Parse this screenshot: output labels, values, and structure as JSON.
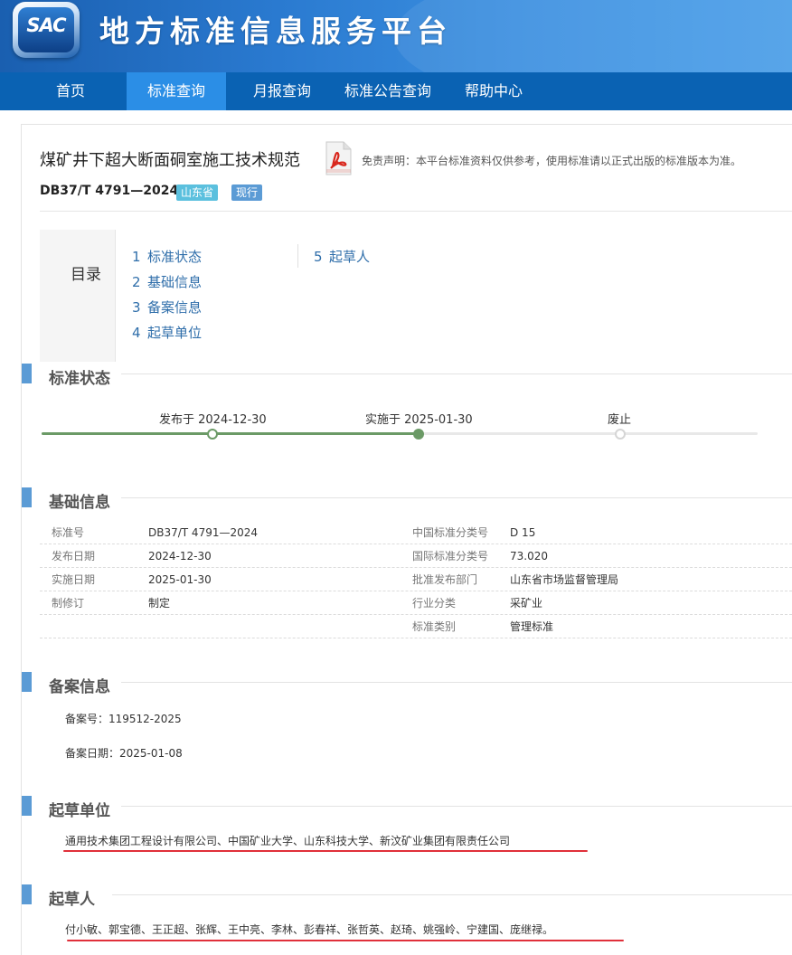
{
  "header": {
    "logo_text": "SAC",
    "site_title": "地方标准信息服务平台"
  },
  "nav": {
    "items": [
      {
        "label": "首页",
        "active": false
      },
      {
        "label": "标准查询",
        "active": true
      },
      {
        "label": "月报查询",
        "active": false
      },
      {
        "label": "标准公告查询",
        "active": false
      },
      {
        "label": "帮助中心",
        "active": false
      }
    ]
  },
  "doc": {
    "title": "煤矿井下超大断面硐室施工技术规范",
    "pdf_icon": "pdf-icon",
    "disclaimer": "免责声明：本平台标准资料仅供参考，使用标准请以正式出版的标准版本为准。",
    "code": "DB37/T 4791—2024",
    "province_badge": "山东省",
    "status_badge": "现行"
  },
  "toc": {
    "label": "目录",
    "items": [
      {
        "num": "1",
        "label": "标准状态"
      },
      {
        "num": "2",
        "label": "基础信息"
      },
      {
        "num": "3",
        "label": "备案信息"
      },
      {
        "num": "4",
        "label": "起草单位"
      },
      {
        "num": "5",
        "label": "起草人"
      }
    ]
  },
  "status_section": {
    "title": "标准状态",
    "timeline": [
      {
        "label": "发布于 2024-12-30",
        "state": "done"
      },
      {
        "label": "实施于 2025-01-30",
        "state": "current"
      },
      {
        "label": "废止",
        "state": "pending"
      }
    ],
    "progress_fraction": 0.53
  },
  "basic_section": {
    "title": "基础信息",
    "rows": [
      {
        "l1": "标准号",
        "v1": "DB37/T 4791—2024",
        "l2": "中国标准分类号",
        "v2": "D 15"
      },
      {
        "l1": "发布日期",
        "v1": "2024-12-30",
        "l2": "国际标准分类号",
        "v2": "73.020"
      },
      {
        "l1": "实施日期",
        "v1": "2025-01-30",
        "l2": "批准发布部门",
        "v2": "山东省市场监督管理局"
      },
      {
        "l1": "制修订",
        "v1": "制定",
        "l2": "行业分类",
        "v2": "采矿业"
      },
      {
        "l1": "",
        "v1": "",
        "l2": "标准类别",
        "v2": "管理标准"
      }
    ]
  },
  "record_section": {
    "title": "备案信息",
    "record_no": "备案号：119512-2025",
    "record_date": "备案日期：2025-01-08"
  },
  "drafting_units_section": {
    "title": "起草单位",
    "text": "通用技术集团工程设计有限公司、中国矿业大学、山东科技大学、新汶矿业集团有限责任公司"
  },
  "drafters_section": {
    "title": "起草人",
    "text": "付小敏、郭宝德、王正超、张辉、王中亮、李林、彭春祥、张哲英、赵琦、姚强岭、宁建国、庞继禄。"
  },
  "colors": {
    "header_blue": "#1a5fb0",
    "nav_blue": "#0a62b3",
    "nav_active": "#2b8ee6",
    "section_bar": "#5b9bd5",
    "timeline_green": "#6b9a66",
    "annotation_red": "#e0303a"
  }
}
